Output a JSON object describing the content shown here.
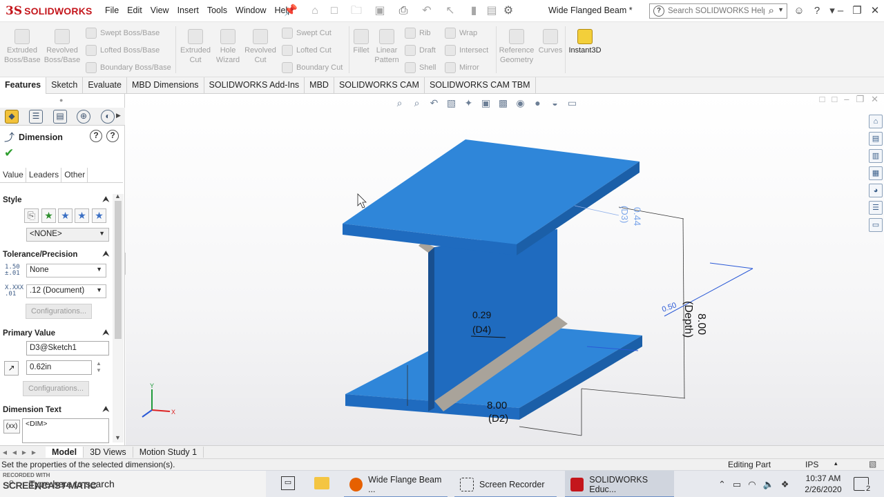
{
  "app": {
    "brand_ds": "3S",
    "brand_name": "SOLIDWORKS",
    "doc_title": "Wide Flanged Beam *"
  },
  "menu": [
    "File",
    "Edit",
    "View",
    "Insert",
    "Tools",
    "Window",
    "Help"
  ],
  "search": {
    "placeholder": "Search SOLIDWORKS Help"
  },
  "ribbon": {
    "extruded_boss": [
      "Extruded",
      "Boss/Base"
    ],
    "revolved_boss": [
      "Revolved",
      "Boss/Base"
    ],
    "swept_boss": "Swept Boss/Base",
    "lofted_boss": "Lofted Boss/Base",
    "boundary_boss": "Boundary Boss/Base",
    "extruded_cut": [
      "Extruded",
      "Cut"
    ],
    "hole_wizard": [
      "Hole",
      "Wizard"
    ],
    "revolved_cut": [
      "Revolved",
      "Cut"
    ],
    "swept_cut": "Swept Cut",
    "lofted_cut": "Lofted Cut",
    "boundary_cut": "Boundary Cut",
    "fillet": "Fillet",
    "linear_pattern": [
      "Linear",
      "Pattern"
    ],
    "rib": "Rib",
    "draft": "Draft",
    "shell": "Shell",
    "wrap": "Wrap",
    "intersect": "Intersect",
    "mirror": "Mirror",
    "reference_geometry": [
      "Reference",
      "Geometry"
    ],
    "curves": "Curves",
    "instant3d": "Instant3D"
  },
  "cm_tabs": [
    "Features",
    "Sketch",
    "Evaluate",
    "MBD Dimensions",
    "SOLIDWORKS Add-Ins",
    "MBD",
    "SOLIDWORKS CAM",
    "SOLIDWORKS CAM TBM"
  ],
  "property_manager": {
    "title": "Dimension",
    "tabs": [
      "Value",
      "Leaders",
      "Other"
    ],
    "style_label": "Style",
    "style_value": "<NONE>",
    "tolerance_label": "Tolerance/Precision",
    "tolerance_type": "None",
    "precision": ".12 (Document)",
    "tol_icon_text": "1.50 ±.01",
    "prec_icon_text": "X.XXX .01",
    "configurations_btn": "Configurations...",
    "primary_value_label": "Primary Value",
    "primary_name": "D3@Sketch1",
    "primary_value": "0.62in",
    "dimension_text_label": "Dimension Text",
    "dim_text_icon": "(xx)",
    "dim_text_value": "<DIM>"
  },
  "dimensions": {
    "d3_value": "0.44",
    "d3_name": "(D3)",
    "d4_value": "0.29",
    "d4_name": "(D4)",
    "d2_value": "8.00",
    "d2_name": "(D2)",
    "depth_value": "8.00",
    "depth_name": "(Depth)",
    "small_value": "0.50"
  },
  "triad": {
    "y": "Y",
    "x": "X"
  },
  "bottom_tabs": [
    "Model",
    "3D Views",
    "Motion Study 1"
  ],
  "status": {
    "message": "Set the properties of the selected dimension(s).",
    "mode": "Editing Part",
    "units": "IPS"
  },
  "taskbar": {
    "recorded_with": "RECORDED WITH",
    "rec_brand": "SCREENCAST-MATIC",
    "search_text": "Type here to search",
    "items": [
      "Wide Flange Beam ...",
      "Screen Recorder",
      "SOLIDWORKS Educ..."
    ],
    "time": "10:37 AM",
    "date": "2/26/2020",
    "notifications": "2"
  },
  "colors": {
    "beam_top": "#2f86d9",
    "beam_side": "#1f6bbf",
    "beam_dark": "#184f8f",
    "fillet_gray": "#a9a39a",
    "brand_red": "#c4161c",
    "dim_blue": "#2a59d6"
  }
}
